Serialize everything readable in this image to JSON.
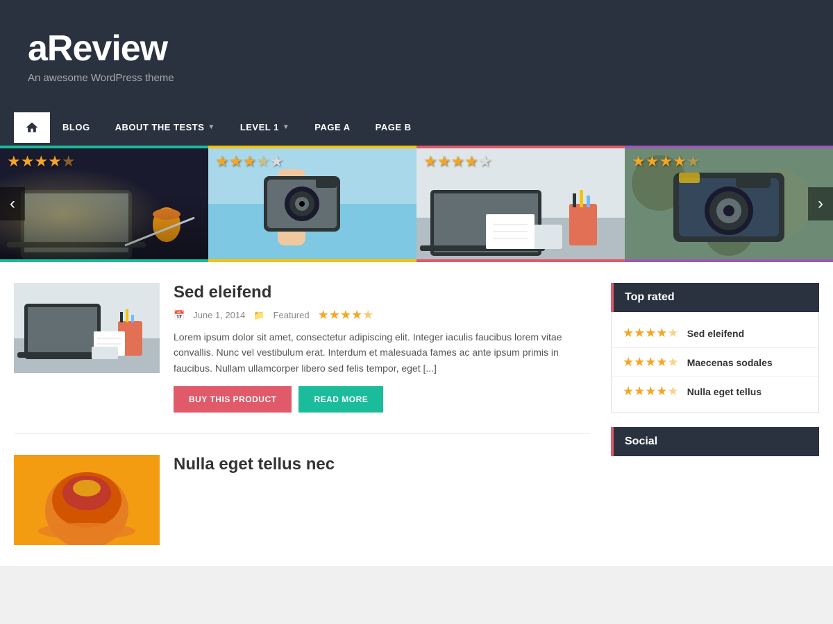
{
  "site": {
    "title": "aReview",
    "subtitle": "An awesome WordPress theme"
  },
  "nav": {
    "home_label": "Home",
    "items": [
      {
        "label": "BLOG",
        "has_arrow": false
      },
      {
        "label": "ABOUT THE TESTS",
        "has_arrow": true
      },
      {
        "label": "LEVEL 1",
        "has_arrow": true
      },
      {
        "label": "PAGE A",
        "has_arrow": false
      },
      {
        "label": "PAGE B",
        "has_arrow": false
      }
    ]
  },
  "carousel": {
    "prev_label": "‹",
    "next_label": "›",
    "items": [
      {
        "stars": 4.5,
        "alt": "Laptop on desk with coffee"
      },
      {
        "stars": 3.5,
        "alt": "Person holding camera"
      },
      {
        "stars": 4.0,
        "alt": "Laptop on desk with supplies"
      },
      {
        "stars": 4.0,
        "alt": "Camera on wooden table"
      }
    ]
  },
  "posts": [
    {
      "title": "Sed eleifend",
      "date": "June 1, 2014",
      "category": "Featured",
      "stars": 4.5,
      "excerpt": "Lorem ipsum dolor sit amet, consectetur adipiscing elit. Integer iaculis faucibus lorem vitae convallis. Nunc vel vestibulum erat. Interdum et malesuada fames ac ante ipsum primis in faucibus. Nullam ullamcorper libero sed felis tempor, eget [...]",
      "btn_buy": "BUY THIS PRODUCT",
      "btn_read": "READ MORE"
    },
    {
      "title": "Nulla eget tellus nec",
      "date": "",
      "category": "",
      "stars": 0,
      "excerpt": ""
    }
  ],
  "sidebar": {
    "top_rated": {
      "header": "Top rated",
      "items": [
        {
          "title": "Sed eleifend",
          "stars": 4.5
        },
        {
          "title": "Maecenas sodales",
          "stars": 4.5
        },
        {
          "title": "Nulla eget tellus",
          "stars": 4.5
        }
      ]
    },
    "social": {
      "header": "Social"
    }
  },
  "colors": {
    "teal": "#1abc9c",
    "yellow": "#f1c40f",
    "red": "#e05a6a",
    "purple": "#9b59b6",
    "dark": "#2a3240",
    "star": "#f5a623"
  }
}
